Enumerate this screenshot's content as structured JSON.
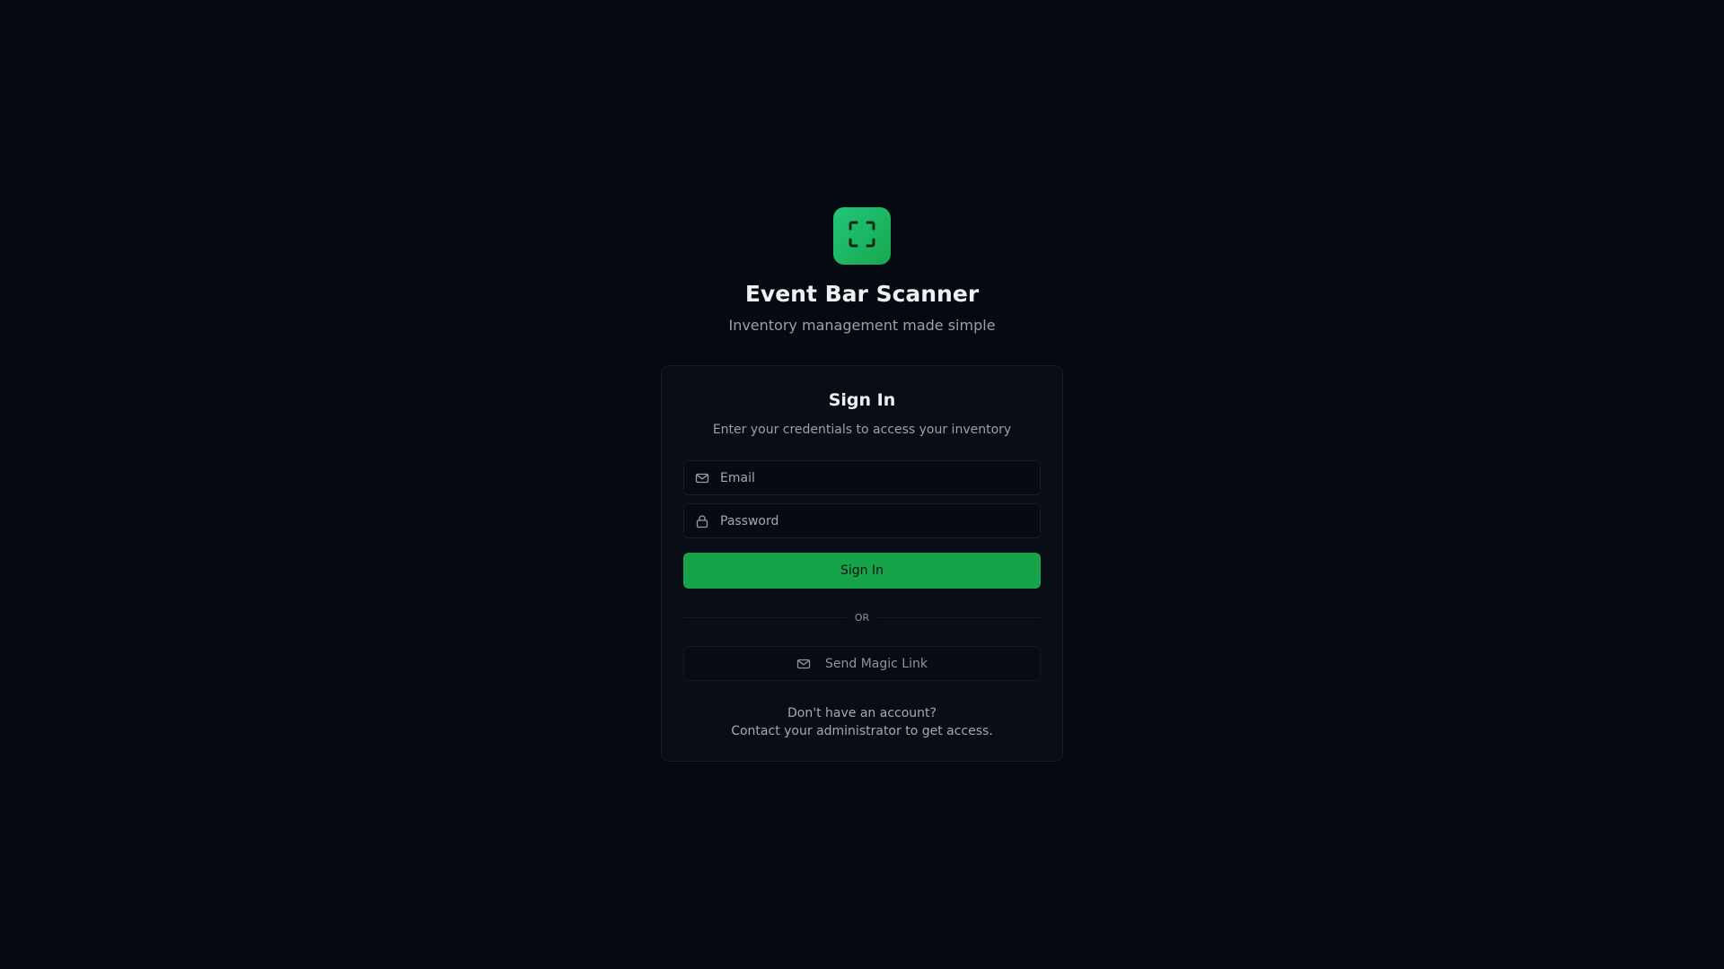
{
  "app": {
    "title": "Event Bar Scanner",
    "subtitle": "Inventory management made simple",
    "logo_icon": "scan-frame-icon"
  },
  "signin": {
    "title": "Sign In",
    "description": "Enter your credentials to access your inventory",
    "email": {
      "placeholder": "Email",
      "value": "",
      "icon": "mail-icon"
    },
    "password": {
      "placeholder": "Password",
      "value": "",
      "icon": "lock-icon"
    },
    "submit_label": "Sign In",
    "divider_label": "OR",
    "magic_link_label": "Send Magic Link",
    "magic_link_icon": "mail-icon",
    "footer_line1": "Don't have an account?",
    "footer_line2": "Contact your administrator to get access."
  },
  "colors": {
    "background": "#050912",
    "card": "#090d16",
    "accent": "#17a34a",
    "logo_gradient_start": "#22c57a",
    "logo_gradient_end": "#17a84f"
  }
}
